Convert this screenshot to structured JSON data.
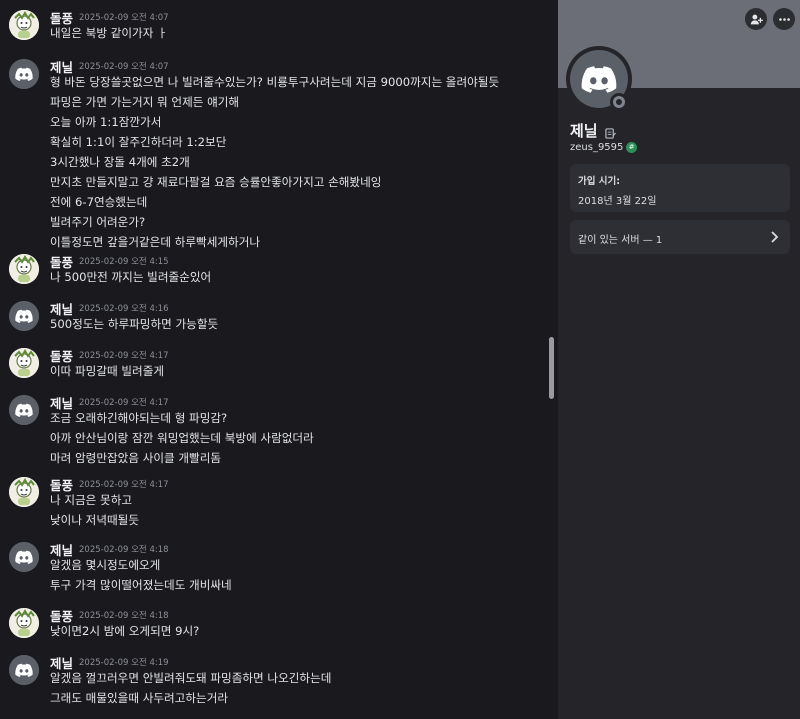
{
  "messages": [
    {
      "author": "돌풍",
      "avatar": "dudung",
      "timestamp": "2025-02-09 오전 4:07",
      "lines": [
        "내일은 북방 같이가자 ㅏ"
      ]
    },
    {
      "author": "제닐",
      "avatar": "discord",
      "timestamp": "2025-02-09 오전 4:07",
      "lines": [
        "형 바돈 당장쓸곳없으면 나 빌려줄수있는가? 비룡투구사려는데 지금 9000까지는 올려야될듯",
        "파밍은 가면 가는거지 뭐 언제든 얘기해",
        "오늘 아까 1:1잠깐가서",
        "확실히 1:1이 잘주긴하더라 1:2보단",
        "3시간했나 장돌 4개에 초2개",
        "만지초 만들지말고 걍 재료다팔걸 요즘 승률안좋아가지고 손해봤네잉",
        "전에 6-7연승했는데",
        "빌려주기 어려운가?",
        "이틀정도면 갚을거같은데 하루빡세게하거나"
      ]
    },
    {
      "author": "돌풍",
      "avatar": "dudung",
      "timestamp": "2025-02-09 오전 4:15",
      "lines": [
        "나 500만전 까지는 빌려줄순있어"
      ]
    },
    {
      "author": "제닐",
      "avatar": "discord",
      "timestamp": "2025-02-09 오전 4:16",
      "lines": [
        "500정도는 하루파밍하면 가능할듯"
      ]
    },
    {
      "author": "돌풍",
      "avatar": "dudung",
      "timestamp": "2025-02-09 오전 4:17",
      "lines": [
        "이따 파밍갈때 빌려줄게"
      ]
    },
    {
      "author": "제닐",
      "avatar": "discord",
      "timestamp": "2025-02-09 오전 4:17",
      "lines": [
        "조금 오래하긴해야되는데 형 파밍감?",
        "아까 안산님이랑 잠깐 워밍업했는데 북방에 사람없더라",
        "마려 암령만잡았음 사이클 개빨리돔"
      ]
    },
    {
      "author": "돌풍",
      "avatar": "dudung",
      "timestamp": "2025-02-09 오전 4:17",
      "lines": [
        "나 지금은 못하고",
        "낮이나 저녁때될듯"
      ]
    },
    {
      "author": "제닐",
      "avatar": "discord",
      "timestamp": "2025-02-09 오전 4:18",
      "lines": [
        "알겠음 몇시정도에오게",
        "투구 가격 많이떨어졌는데도 개비싸네"
      ]
    },
    {
      "author": "돌풍",
      "avatar": "dudung",
      "timestamp": "2025-02-09 오전 4:18",
      "lines": [
        "낮이면2시 밤에 오게되면 9시?"
      ]
    },
    {
      "author": "제닐",
      "avatar": "discord",
      "timestamp": "2025-02-09 오전 4:19",
      "lines": [
        "알겠음 껄끄러우면 안빌려줘도돼 파밍좀하면 나오긴하는데",
        "그래도 매물있을때 사두려고하는거라"
      ]
    }
  ],
  "profile": {
    "display_name": "제닐",
    "username": "zeus_9595",
    "joined_label": "가입 시기:",
    "joined_date": "2018년 3월 22일",
    "mutual_servers": "같이 있는 서버 — 1",
    "status": "offline",
    "icons": [
      "add-friend-icon",
      "more-icon",
      "discord-logo-icon",
      "edit-note-icon",
      "hashtag-badge-icon",
      "chevron-right-icon"
    ]
  },
  "colors": {
    "chat_bg": "#1a1a1e",
    "panel_bg": "#242429",
    "banner": "#6b6e76",
    "card": "#2e2f35"
  }
}
